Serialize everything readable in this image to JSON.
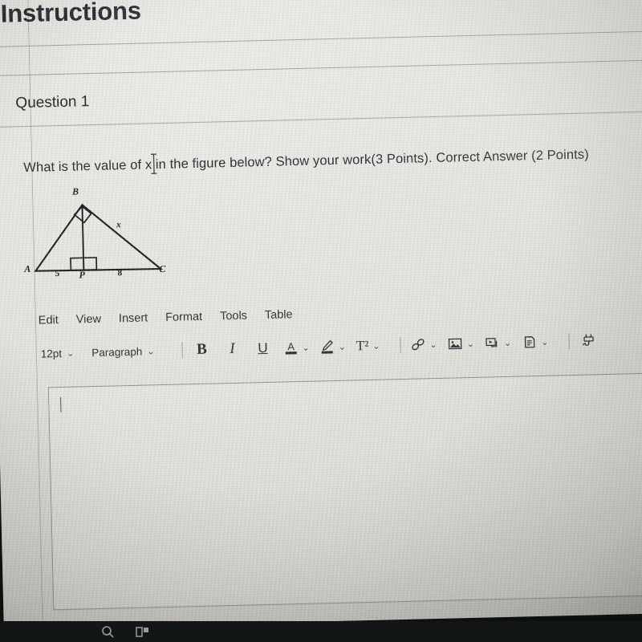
{
  "document": {
    "instructions_title": "Instructions",
    "question_title": "Question 1",
    "question_text": "What is the value of x in the figure below? Show your work(3 Points). Correct Answer (2 Points)"
  },
  "figure": {
    "description": "Right triangle ABC with altitude BP from vertex B to hypotenuse AC",
    "vertex_a": "A",
    "vertex_b": "B",
    "vertex_c": "C",
    "foot_point": "P",
    "segment_ap": "5",
    "segment_pc": "8",
    "side_bc": "x",
    "right_angle_at_b": true,
    "right_angle_at_p": true
  },
  "editor": {
    "menu": [
      {
        "label": "Edit",
        "name": "menu-edit"
      },
      {
        "label": "View",
        "name": "menu-view"
      },
      {
        "label": "Insert",
        "name": "menu-insert"
      },
      {
        "label": "Format",
        "name": "menu-format"
      },
      {
        "label": "Tools",
        "name": "menu-tools"
      },
      {
        "label": "Table",
        "name": "menu-table"
      }
    ],
    "font_size": "12pt",
    "block_format": "Paragraph",
    "caret_glyph": "⌄",
    "buttons": {
      "bold": "B",
      "italic": "I",
      "underline": "U",
      "text_color": "A",
      "highlight": "highlight-pen-icon",
      "superscript": "T²",
      "link": "link-icon",
      "image": "image-icon",
      "media": "media-icon",
      "document": "document-icon",
      "embed": "embed-plug-icon"
    },
    "body_value": "",
    "body_placeholder": ""
  },
  "taskbar": {
    "search_icon": "search-icon",
    "task_view_icon": "task-view-icon"
  },
  "colors": {
    "page_background": "#e9e8e3",
    "text": "#22242a",
    "rule": "#696a6c",
    "taskbar": "#131617",
    "figure_stroke": "#1d1f23"
  }
}
